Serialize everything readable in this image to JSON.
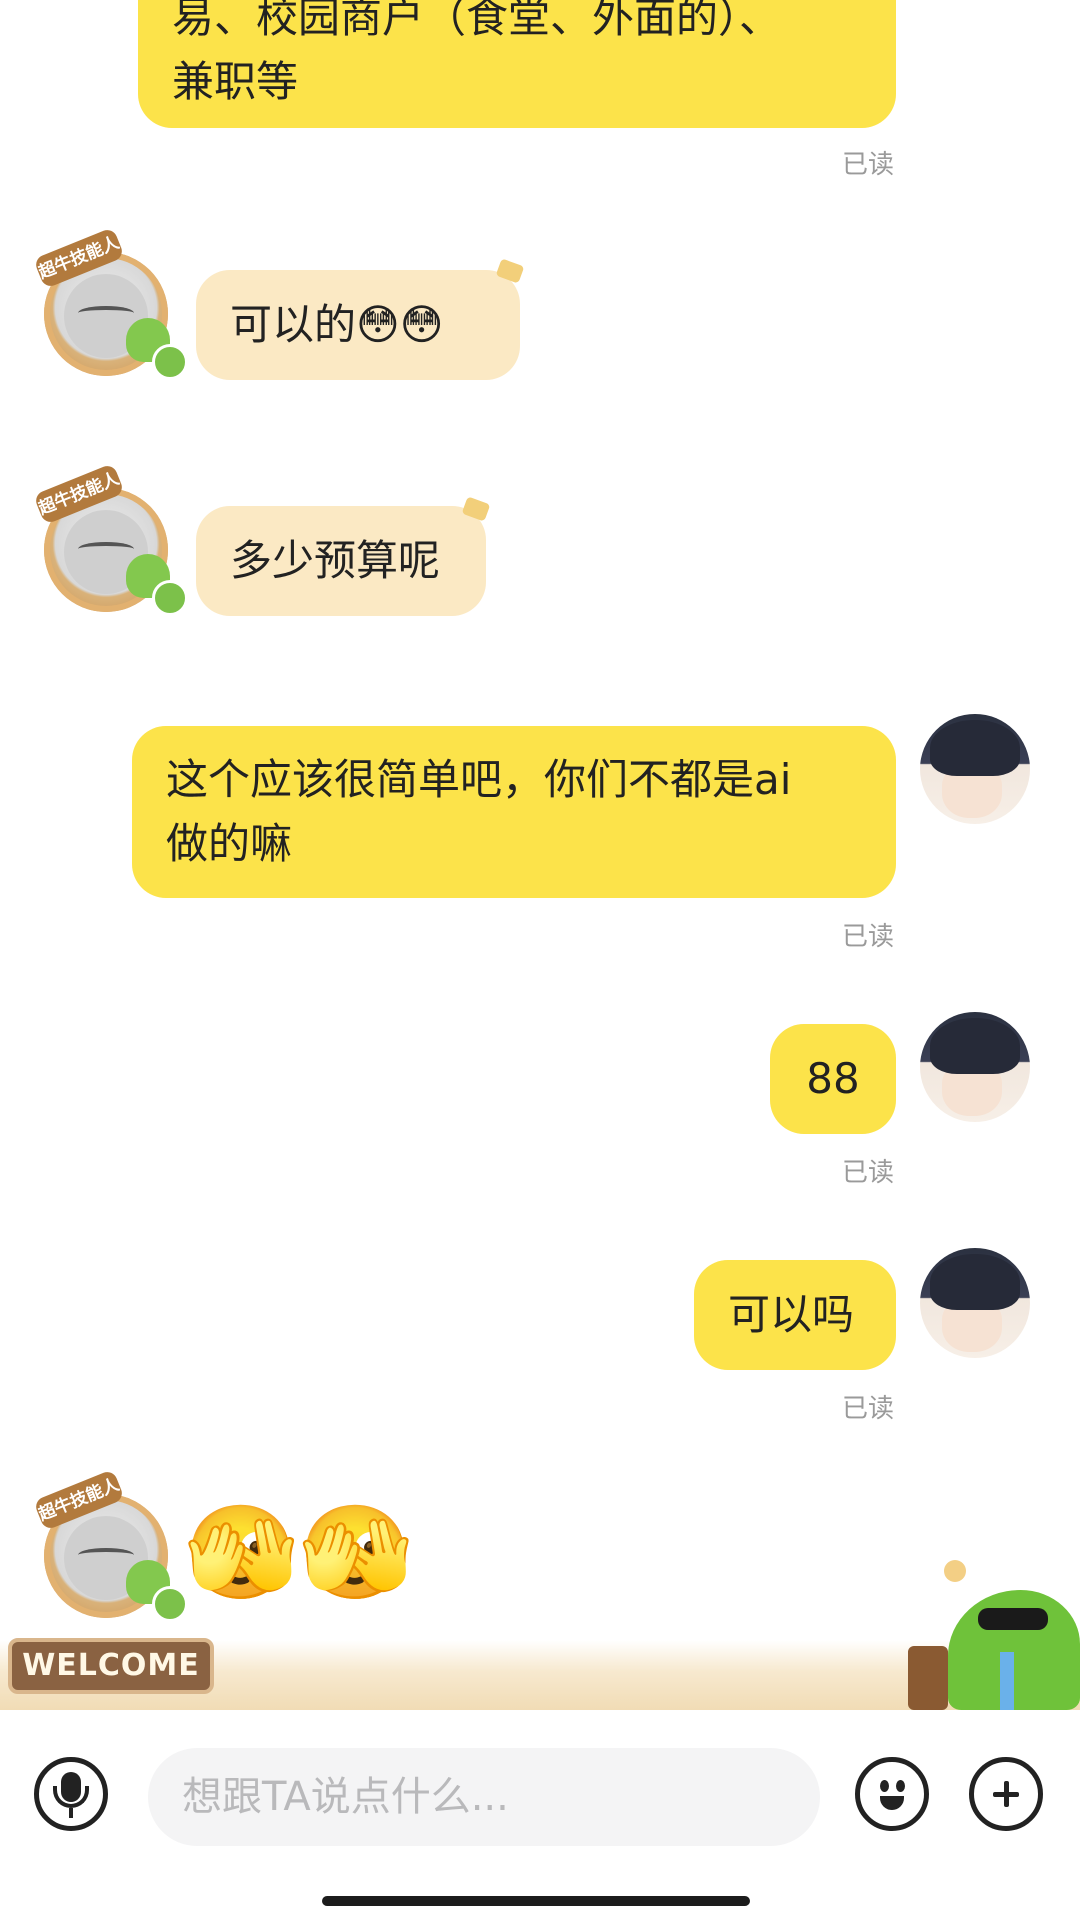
{
  "messages": {
    "m1": {
      "text_line1": "易、校园商户（食堂、外面的）、",
      "text_line2": "兼职等",
      "status": "已读"
    },
    "m2": {
      "text": "可以的😳😳"
    },
    "m3": {
      "text": "多少预算呢"
    },
    "m4": {
      "text_line1": "这个应该很简单吧，你们不都是ai",
      "text_line2": "做的嘛",
      "status": "已读"
    },
    "m5": {
      "text": "88",
      "status": "已读"
    },
    "m6": {
      "text": "可以吗",
      "status": "已读"
    },
    "m7": {
      "emoji": "🫣🫣"
    }
  },
  "avatar_badge": "超牛技能人",
  "banner": {
    "welcome": "WELCOME"
  },
  "input": {
    "placeholder": "想跟TA说点什么..."
  },
  "icons": {
    "mic": "microphone-icon",
    "emoji": "smiley-face-icon",
    "add": "plus-circle-icon"
  },
  "colors": {
    "outgoing_bubble": "#fce34a",
    "incoming_bubble": "#fbe9c4",
    "read_status": "#9a9a9a",
    "input_bg": "#f4f4f5"
  }
}
